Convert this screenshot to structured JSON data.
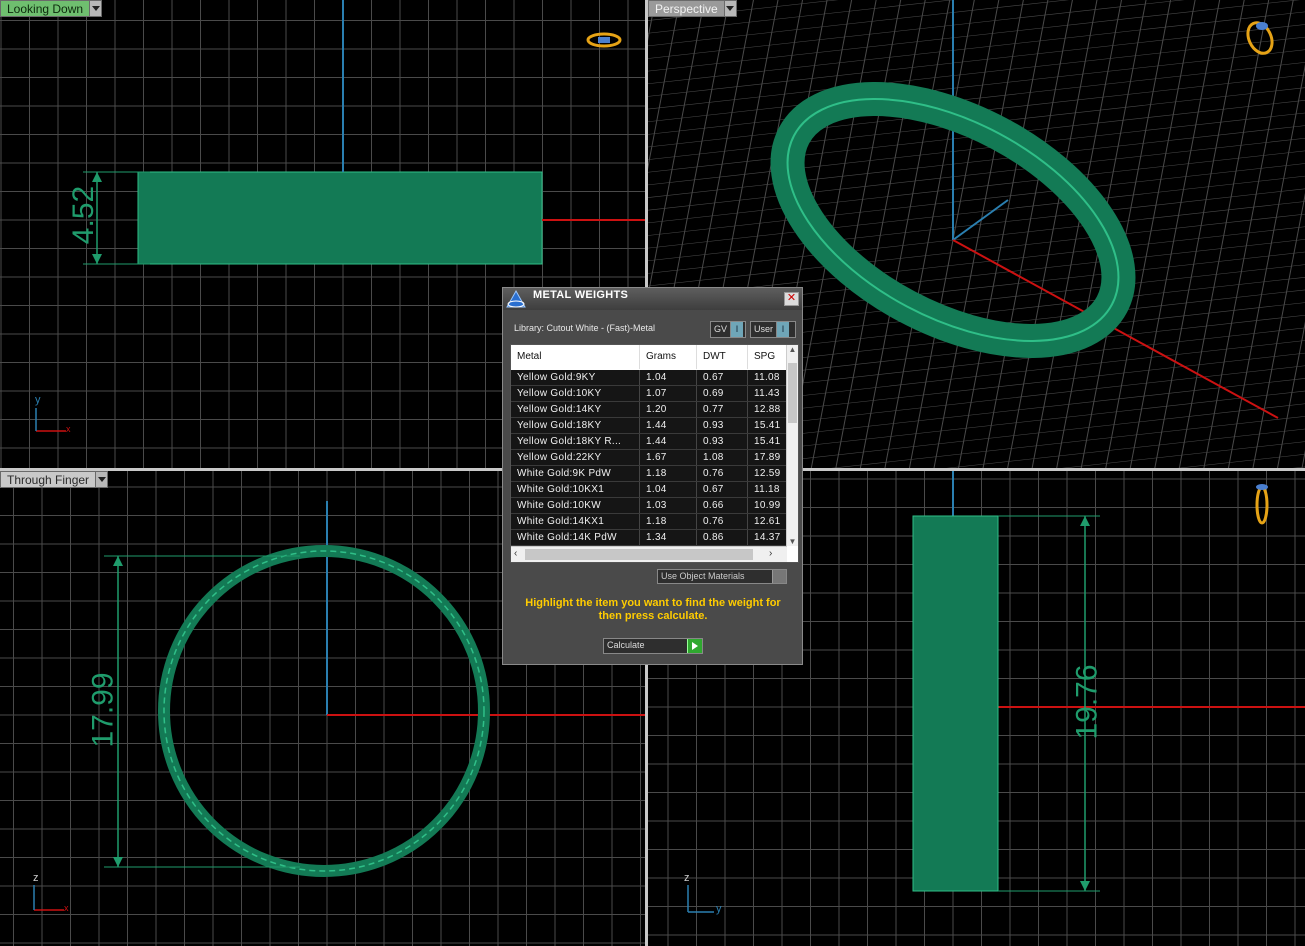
{
  "viewports": {
    "top_left": {
      "label": "Looking Down",
      "dimension": "4.52"
    },
    "top_right": {
      "label": "Perspective"
    },
    "bottom_left": {
      "label": "Through Finger",
      "dimension": "17.99"
    },
    "bottom_right": {
      "label": "",
      "dimension": "19.76"
    }
  },
  "axes": {
    "x": "x",
    "y": "y",
    "z": "z"
  },
  "colors": {
    "model": "#1f9c6c",
    "grid": "#4a4a4a",
    "axis_x": "#cc1111",
    "axis_y": "#2a7fb0",
    "hint": "#ffcc00"
  },
  "dialog": {
    "title": "METAL WEIGHTS",
    "library": "Library: Cutout White - (Fast)-Metal",
    "toggle_gv": "GV",
    "toggle_user": "User",
    "columns": [
      "Metal",
      "Grams",
      "DWT",
      "SPG"
    ],
    "rows": [
      [
        "Yellow Gold:9KY",
        "1.04",
        "0.67",
        "11.08"
      ],
      [
        "Yellow Gold:10KY",
        "1.07",
        "0.69",
        "11.43"
      ],
      [
        "Yellow Gold:14KY",
        "1.20",
        "0.77",
        "12.88"
      ],
      [
        "Yellow Gold:18KY",
        "1.44",
        "0.93",
        "15.41"
      ],
      [
        "Yellow Gold:18KY R...",
        "1.44",
        "0.93",
        "15.41"
      ],
      [
        "Yellow Gold:22KY",
        "1.67",
        "1.08",
        "17.89"
      ],
      [
        "White Gold:9K PdW",
        "1.18",
        "0.76",
        "12.59"
      ],
      [
        "White Gold:10KX1",
        "1.04",
        "0.67",
        "11.18"
      ],
      [
        "White Gold:10KW",
        "1.03",
        "0.66",
        "10.99"
      ],
      [
        "White Gold:14KX1",
        "1.18",
        "0.76",
        "12.61"
      ],
      [
        "White Gold:14K PdW",
        "1.34",
        "0.86",
        "14.37"
      ]
    ],
    "use_object_materials": "Use Object Materials",
    "hint": "Highlight the item you want to find the weight for then press calculate.",
    "calculate": "Calculate"
  }
}
